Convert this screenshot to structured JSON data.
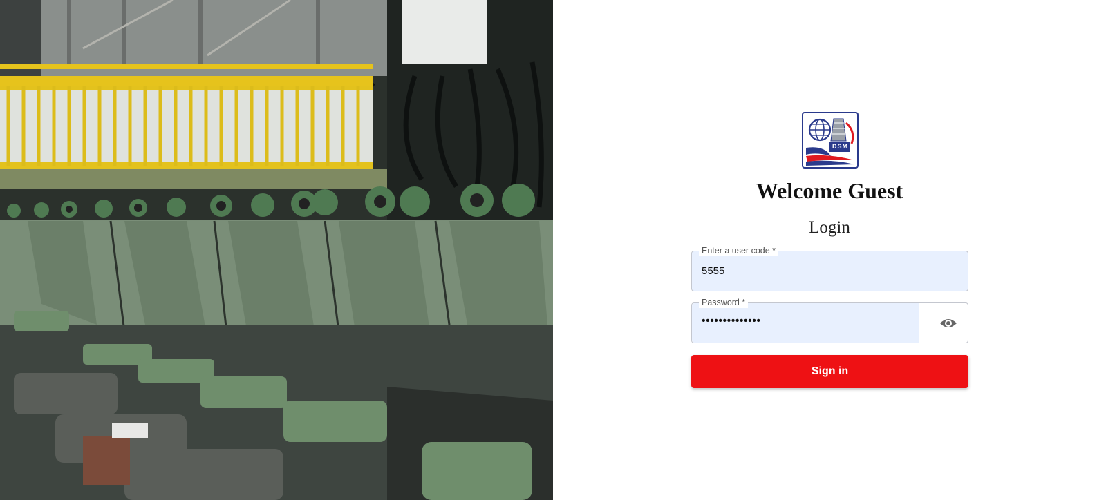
{
  "hero": {
    "description_icon": "factory-rollers-photo"
  },
  "logo": {
    "icon": "dsm-globe-spool-logo",
    "text": "DSM",
    "colors": {
      "blue": "#2a3a8c",
      "red": "#e0191f"
    }
  },
  "header": {
    "welcome": "Welcome Guest",
    "login_title": "Login"
  },
  "form": {
    "user_code": {
      "label": "Enter a user code *",
      "value": "5555"
    },
    "password": {
      "label": "Password *",
      "value": "••••••••••••••",
      "toggle_icon": "eye-icon"
    },
    "submit_label": "Sign in"
  },
  "colors": {
    "accent": "#ee1114",
    "autofill": "#e8f0fe"
  }
}
